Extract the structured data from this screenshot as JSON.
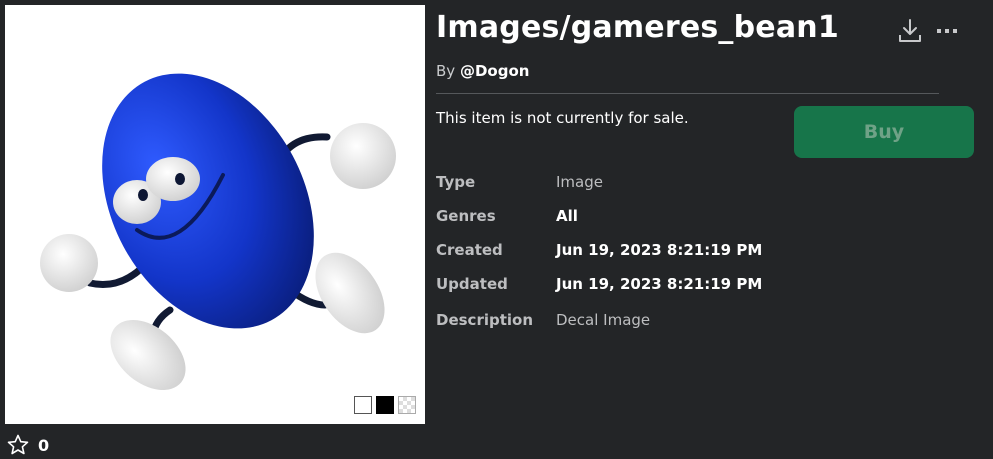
{
  "item": {
    "title": "Images/gameres_bean1",
    "by_label": "By",
    "creator": "@Dogon",
    "sale_status": "This item is not currently for sale.",
    "buy_label": "Buy",
    "favorites": "0"
  },
  "details": {
    "type_label": "Type",
    "type_value": "Image",
    "genres_label": "Genres",
    "genres_value": "All",
    "created_label": "Created",
    "created_value": "Jun 19, 2023 8:21:19 PM",
    "updated_label": "Updated",
    "updated_value": "Jun 19, 2023 8:21:19 PM",
    "description_label": "Description",
    "description_value": "Decal Image"
  },
  "icons": [
    "download-icon",
    "more-options-icon",
    "star-icon"
  ],
  "colors": {
    "background": "#232527",
    "buy_button": "#17754a",
    "bean": "#1335c9"
  }
}
